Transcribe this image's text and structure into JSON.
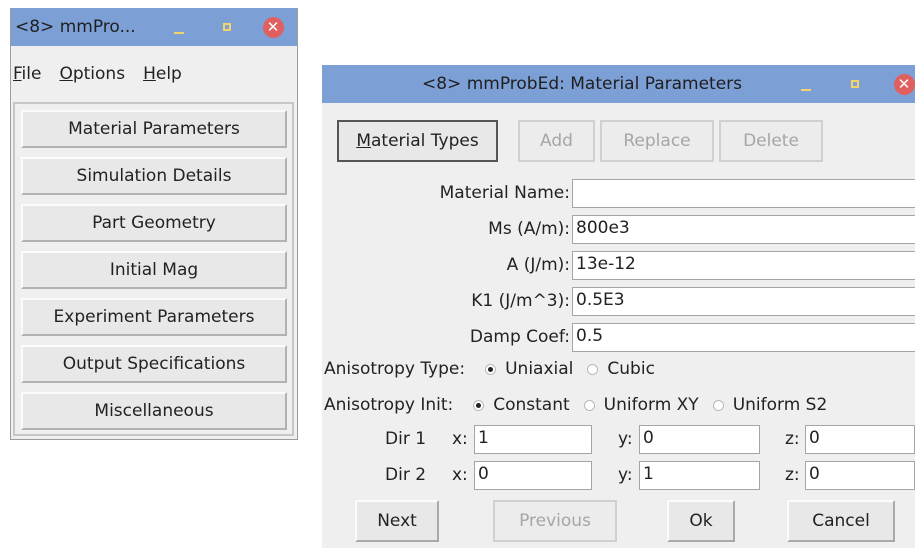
{
  "main_window": {
    "title": "<8> mmPro...",
    "menus": [
      {
        "key": "F",
        "rest": "ile"
      },
      {
        "key": "O",
        "rest": "ptions"
      },
      {
        "key": "H",
        "rest": "elp"
      }
    ],
    "nav_buttons": [
      "Material Parameters",
      "Simulation Details",
      "Part Geometry",
      "Initial Mag",
      "Experiment Parameters",
      "Output Specifications",
      "Miscellaneous"
    ]
  },
  "dialog": {
    "title": "<8> mmProbEd: Material Parameters",
    "toolbar": {
      "types_key": "M",
      "types_rest": "aterial Types",
      "add": "Add",
      "replace": "Replace",
      "delete": "Delete"
    },
    "fields": {
      "material_name": {
        "label": "Material Name:",
        "value": ""
      },
      "ms": {
        "label": "Ms (A/m):",
        "value": "800e3"
      },
      "a": {
        "label": "A (J/m):",
        "value": "13e-12"
      },
      "k1": {
        "label": "K1 (J/m^3):",
        "value": "0.5E3"
      },
      "damp": {
        "label": "Damp Coef:",
        "value": "0.5"
      }
    },
    "anisotropy_type": {
      "label": "Anisotropy Type:",
      "options": [
        "Uniaxial",
        "Cubic"
      ],
      "selected": "Uniaxial"
    },
    "anisotropy_init": {
      "label": "Anisotropy Init:",
      "options": [
        "Constant",
        "Uniform XY",
        "Uniform S2"
      ],
      "selected": "Constant"
    },
    "dir1": {
      "label": "Dir 1",
      "x_label": "x:",
      "x": "1",
      "y_label": "y:",
      "y": "0",
      "z_label": "z:",
      "z": "0"
    },
    "dir2": {
      "label": "Dir 2",
      "x_label": "x:",
      "x": "0",
      "y_label": "y:",
      "y": "1",
      "z_label": "z:",
      "z": "0"
    },
    "footer": {
      "next": "Next",
      "previous": "Previous",
      "ok": "Ok",
      "cancel": "Cancel"
    }
  }
}
